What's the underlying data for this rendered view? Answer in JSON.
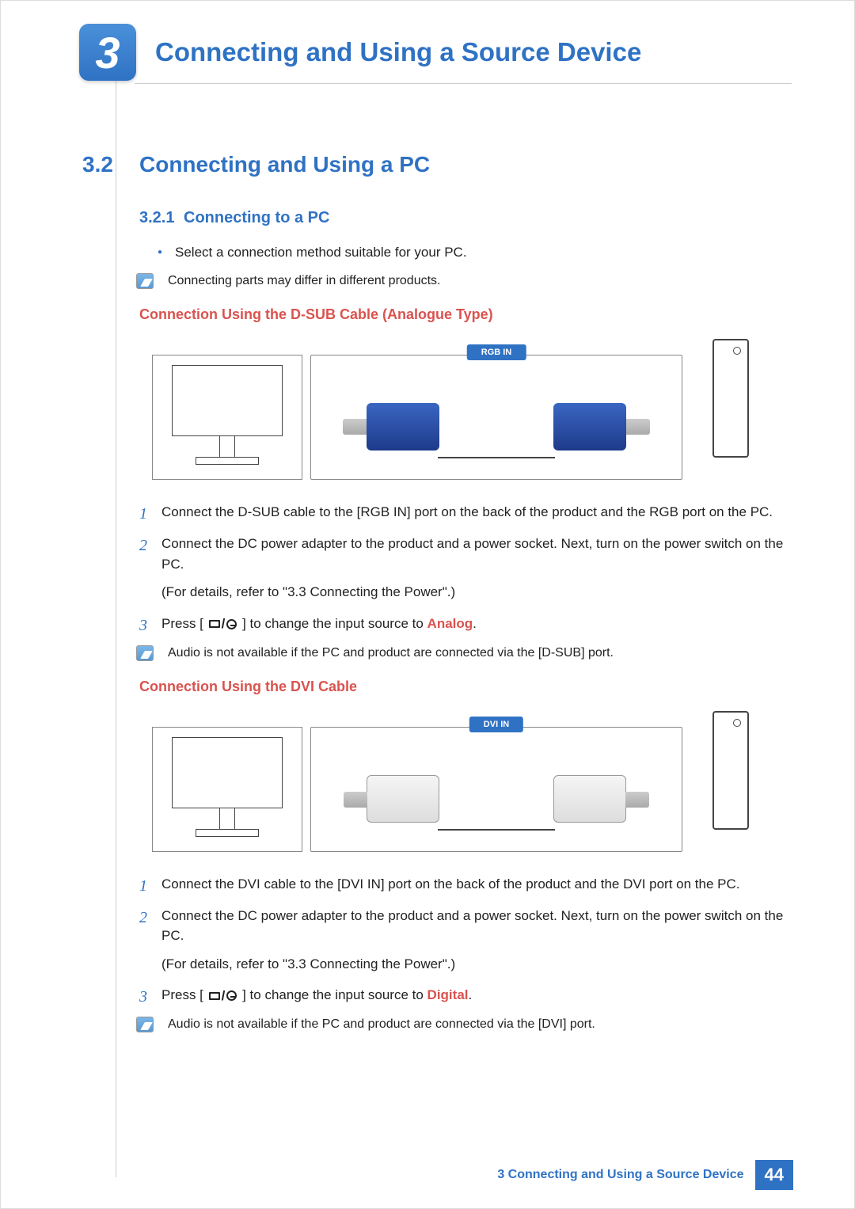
{
  "chapter": {
    "number": "3",
    "title": "Connecting and Using a Source Device"
  },
  "section": {
    "number": "3.2",
    "title": "Connecting and Using a PC"
  },
  "subsection": {
    "number": "3.2.1",
    "title": "Connecting to a PC"
  },
  "bullet": "Select a connection method suitable for your PC.",
  "note_parts_differ": "Connecting parts may differ in different products.",
  "dsub": {
    "heading": "Connection Using the D-SUB Cable (Analogue Type)",
    "port_label": "RGB IN",
    "step1": "Connect the D-SUB cable to the [RGB IN] port on the back of the product and the RGB port on the PC.",
    "step2": "Connect the DC power adapter to the product and a power socket. Next, turn on the power switch on the PC.",
    "step2_detail": "(For details, refer to \"3.3 Connecting the Power\".)",
    "step3a": "Press [",
    "step3b": "] to change the input source to ",
    "step3_source": "Analog",
    "step3_period": ".",
    "note": "Audio is not available if the PC and product are connected via the [D-SUB] port."
  },
  "dvi": {
    "heading": "Connection Using the DVI Cable",
    "port_label": "DVI IN",
    "step1": "Connect the DVI cable to the [DVI IN] port on the back of the product and the DVI port on the PC.",
    "step2": "Connect the DC power adapter to the product and a power socket. Next, turn on the power switch on the PC.",
    "step2_detail": "(For details, refer to \"3.3 Connecting the Power\".)",
    "step3a": "Press [",
    "step3b": "] to change the input source to ",
    "step3_source": "Digital",
    "step3_period": ".",
    "note": "Audio is not available if the PC and product are connected via the [DVI] port."
  },
  "steps_nums": {
    "one": "1",
    "two": "2",
    "three": "3"
  },
  "footer": {
    "text": "3 Connecting and Using a Source Device",
    "page": "44"
  }
}
